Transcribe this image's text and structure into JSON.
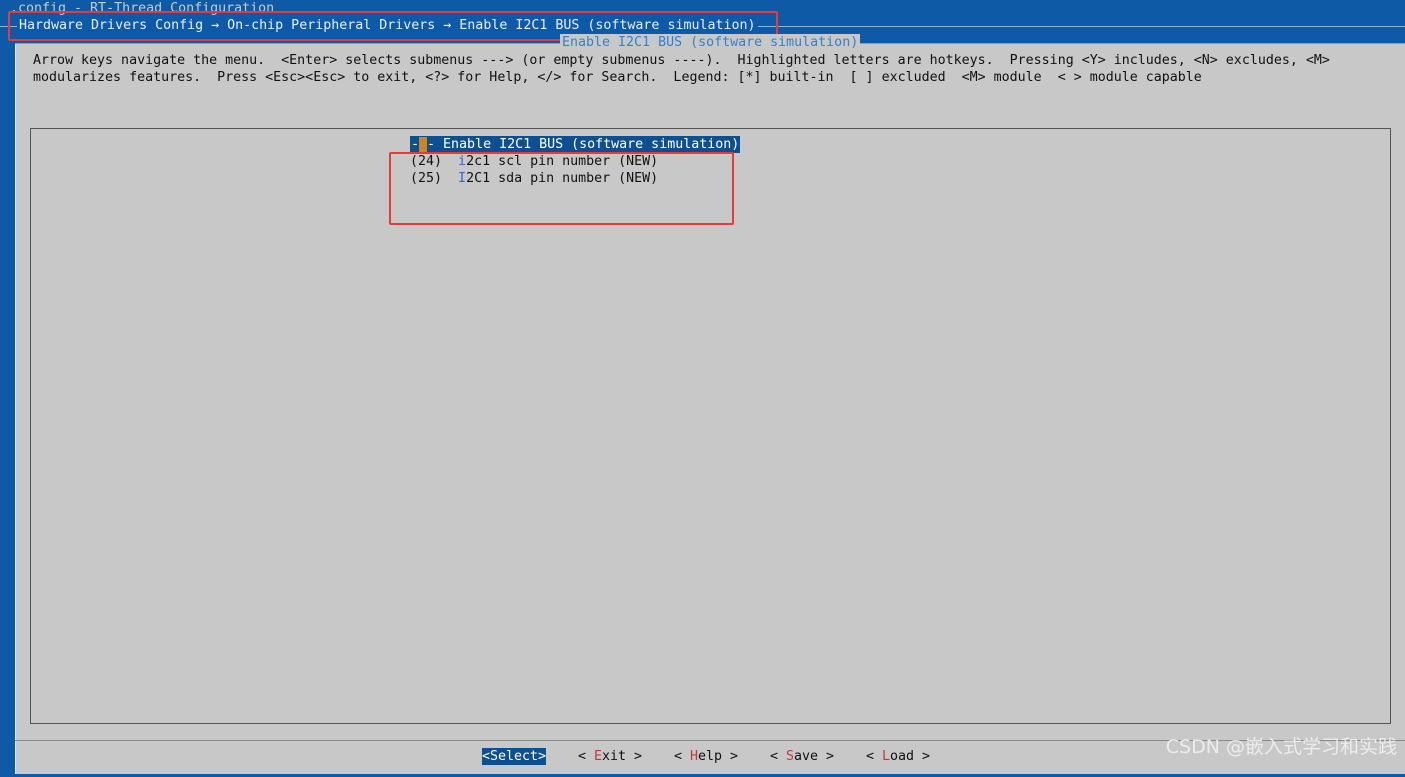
{
  "window": {
    "title": ".config - RT-Thread Configuration"
  },
  "breadcrumb": {
    "text": "Hardware Drivers Config → On-chip Peripheral Drivers → Enable I2C1 BUS (software simulation)"
  },
  "dialog": {
    "title": "Enable I2C1 BUS (software simulation)",
    "help_line1": "Arrow keys navigate the menu.  <Enter> selects submenus ---> (or empty submenus ----).  Highlighted letters are hotkeys.  Pressing <Y> includes, <N> excludes, <M>",
    "help_line2": "modularizes features.  Press <Esc><Esc> to exit, <?> for Help, </> for Search.  Legend: [*] built-in  [ ] excluded  <M> module  < > module capable"
  },
  "menu": {
    "selected": {
      "prefix": "-",
      "dash": "-",
      "suffix": "- Enable I2C1 BUS (software simulation)"
    },
    "items": [
      {
        "value": "(24)",
        "hotkey": "i",
        "rest": "2c1 scl pin number (NEW)"
      },
      {
        "value": "(25)",
        "hotkey": "I",
        "rest": "2C1 sda pin number (NEW)"
      }
    ]
  },
  "buttons": {
    "select": "<Select>",
    "exit": {
      "pre": "< ",
      "hk": "E",
      "rest": "xit >"
    },
    "help": {
      "pre": "< ",
      "hk": "H",
      "rest": "elp >"
    },
    "save": {
      "pre": "< ",
      "hk": "S",
      "rest": "ave >"
    },
    "load": {
      "pre": "< ",
      "hk": "L",
      "rest": "oad >"
    }
  },
  "watermark": "CSDN @嵌入式学习和实践",
  "colors": {
    "background": "#0e5aa7",
    "dialog": "#c8c8c8",
    "highlight": "#0e4f8f",
    "annotation": "#e83a3a"
  }
}
